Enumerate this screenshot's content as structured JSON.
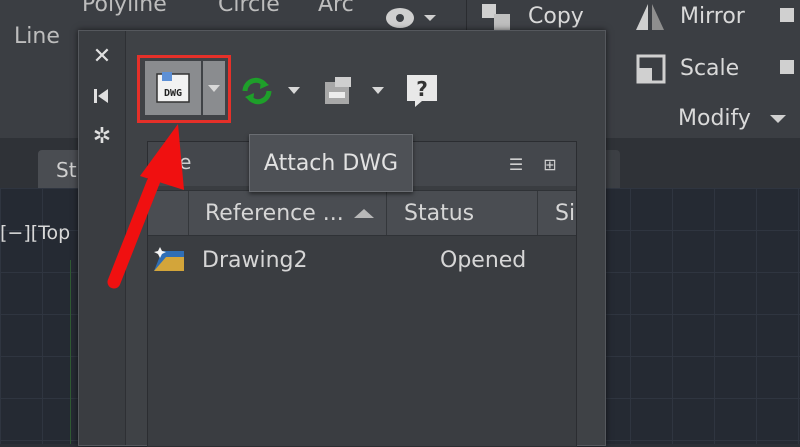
{
  "ribbon": {
    "draw_labels": [
      "Line",
      "Polyline",
      "Circle",
      "Arc"
    ],
    "modify": {
      "copy_label": "Copy",
      "mirror_label": "Mirror",
      "scale_label": "Scale",
      "panel_label": "Modify"
    }
  },
  "doc_tab": {
    "label": "St"
  },
  "viewport": {
    "label": "[−][Top"
  },
  "palette": {
    "side_strip": {
      "close": "close-icon",
      "pin": "pin-icon",
      "settings": "gear-icon"
    },
    "toolbar": {
      "attach_tooltip": "Attach DWG",
      "attach_icon": "dwg-icon",
      "attach_icon_text": "DWG",
      "refresh_icon": "refresh-icon",
      "path_icon": "path-icon",
      "help_icon": "help-icon",
      "help_glyph": "?"
    },
    "files": {
      "header_label": "File",
      "columns": [
        "Reference ...",
        "Status",
        "Si"
      ],
      "rows": [
        {
          "name": "Drawing2",
          "status": "Opened"
        }
      ]
    }
  },
  "annotation": {
    "highlight_color": "#e53029",
    "arrow_color": "#f01010"
  }
}
